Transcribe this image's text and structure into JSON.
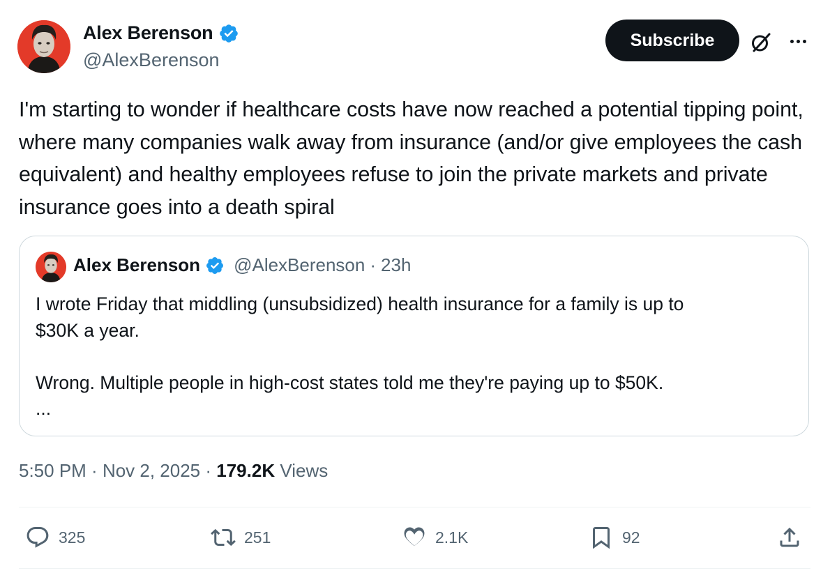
{
  "author": {
    "name": "Alex Berenson",
    "handle": "@AlexBerenson",
    "verified": true
  },
  "header": {
    "subscribe_label": "Subscribe",
    "grok_icon": "grok-slash-icon",
    "more_icon": "more-horizontal-icon"
  },
  "tweet": {
    "text": "I'm starting to wonder if healthcare costs have now reached a potential tipping point, where many companies walk away from insurance (and/or give employees the cash equivalent) and healthy employees refuse to join the private markets and private insurance goes into a death spiral"
  },
  "quote": {
    "name": "Alex Berenson",
    "handle": "@AlexBerenson",
    "separator": "·",
    "time": "23h",
    "text": "I wrote Friday that middling (unsubsidized) health insurance for a family is up to\n$30K a year.\n\nWrong. Multiple people in high-cost states told me they're paying up to $50K.\n..."
  },
  "meta": {
    "time": "5:50 PM",
    "sep1": " · ",
    "date": "Nov 2, 2025",
    "sep2": " · ",
    "views_count": "179.2K",
    "views_label": " Views"
  },
  "actions": {
    "replies": "325",
    "reposts": "251",
    "likes": "2.1K",
    "bookmarks": "92"
  },
  "colors": {
    "text": "#0f1419",
    "secondary": "#536471",
    "verified_blue": "#1d9bf0",
    "border": "#cfd9de",
    "subscribe_bg": "#0f1419"
  }
}
